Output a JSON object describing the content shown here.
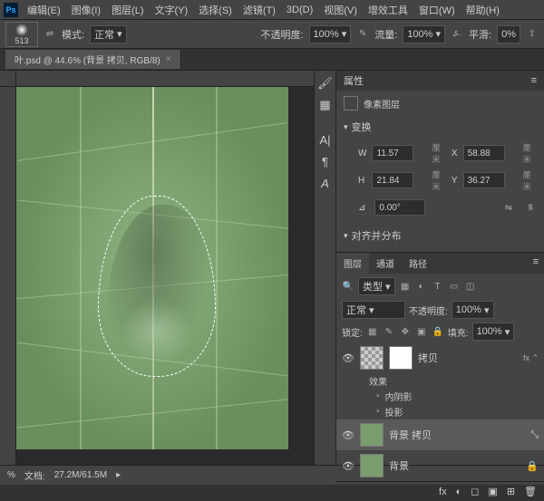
{
  "menu": {
    "items": [
      "编辑(E)",
      "图像(I)",
      "图层(L)",
      "文字(Y)",
      "选择(S)",
      "滤镜(T)",
      "3D(D)",
      "视图(V)",
      "增效工具",
      "窗口(W)",
      "帮助(H)"
    ]
  },
  "options": {
    "brush_size": "513",
    "mode_label": "模式:",
    "mode_value": "正常",
    "opacity_label": "不透明度:",
    "opacity_value": "100%",
    "flow_label": "流量:",
    "flow_value": "100%",
    "smooth_label": "平滑:",
    "smooth_value": "0%"
  },
  "tab": {
    "title": "叶.psd @ 44.6% (背景 拷贝, RGB/8)"
  },
  "properties": {
    "panel_title": "属性",
    "layer_type": "像素图层",
    "transform_title": "变换",
    "w_label": "W",
    "w_value": "11.57",
    "w_unit": "厘米",
    "x_label": "X",
    "x_value": "58.88",
    "x_unit": "厘米",
    "h_label": "H",
    "h_value": "21.84",
    "h_unit": "厘米",
    "y_label": "Y",
    "y_value": "36.27",
    "y_unit": "厘米",
    "angle_value": "0.00°",
    "align_title": "对齐并分布"
  },
  "layers": {
    "tabs": [
      "图层",
      "通道",
      "路径"
    ],
    "filter_label": "类型",
    "mode_value": "正常",
    "opacity_label": "不透明度:",
    "opacity_value": "100%",
    "lock_label": "锁定:",
    "fill_label": "填充:",
    "fill_value": "100%",
    "items": [
      {
        "name": "拷贝",
        "fx_label": "效果",
        "fx": [
          "内阴影",
          "投影"
        ]
      },
      {
        "name": "背景 拷贝"
      },
      {
        "name": "背景"
      }
    ],
    "footer_icons": [
      "fx",
      "◐",
      "◻",
      "▣",
      "⊞",
      "🗑"
    ]
  },
  "status": {
    "file_label": "文档:",
    "file_value": "27.2M/61.5M",
    "pct": "%"
  }
}
